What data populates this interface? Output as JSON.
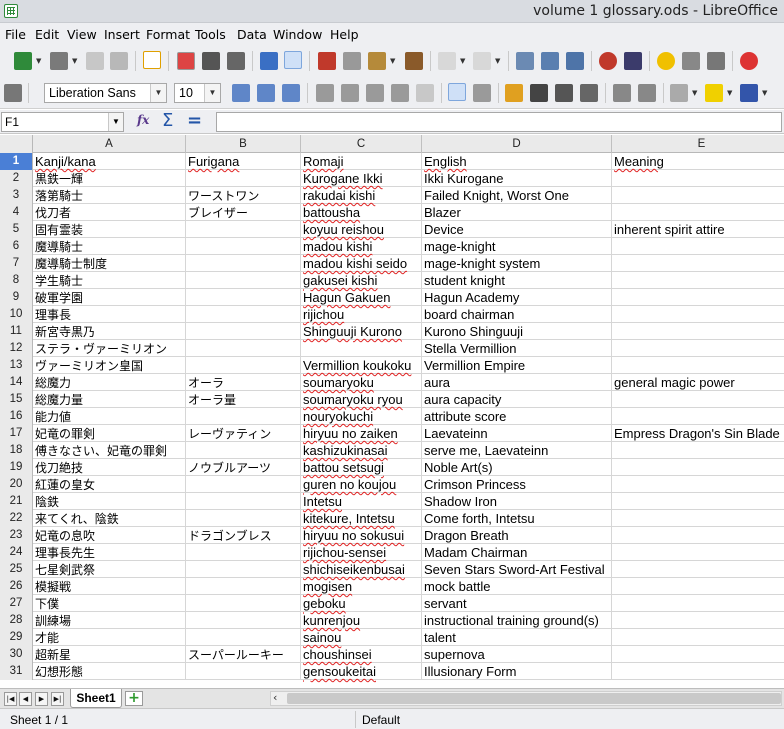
{
  "window": {
    "title": "volume 1 glossary.ods - LibreOffice"
  },
  "menu": [
    "File",
    "Edit",
    "View",
    "Insert",
    "Format",
    "Tools",
    "Data",
    "Window",
    "Help"
  ],
  "format_toolbar": {
    "font_name": "Liberation Sans",
    "font_size": "10"
  },
  "formula_bar": {
    "name_box": "F1",
    "content": ""
  },
  "columns": [
    "A",
    "B",
    "C",
    "D",
    "E"
  ],
  "rows": [
    {
      "n": "1",
      "a": "Kanji/kana",
      "b": "Furigana",
      "c": "Romaji",
      "d": "English",
      "e": "Meaning"
    },
    {
      "n": "2",
      "a": "黒鉄一輝",
      "b": "",
      "c": "Kurogane Ikki",
      "d": "Ikki Kurogane",
      "e": ""
    },
    {
      "n": "3",
      "a": "落第騎士",
      "b": "ワーストワン",
      "c": "rakudai kishi",
      "d": "Failed Knight, Worst One",
      "e": ""
    },
    {
      "n": "4",
      "a": "伐刀者",
      "b": "ブレイザー",
      "c": "battousha",
      "d": "Blazer",
      "e": ""
    },
    {
      "n": "5",
      "a": "固有霊装",
      "b": "",
      "c": "koyuu reishou",
      "d": "Device",
      "e": "inherent spirit attire"
    },
    {
      "n": "6",
      "a": "魔導騎士",
      "b": "",
      "c": "madou kishi",
      "d": "mage-knight",
      "e": ""
    },
    {
      "n": "7",
      "a": "魔導騎士制度",
      "b": "",
      "c": "madou kishi seido",
      "d": "mage-knight system",
      "e": ""
    },
    {
      "n": "8",
      "a": "学生騎士",
      "b": "",
      "c": "gakusei kishi",
      "d": "student knight",
      "e": ""
    },
    {
      "n": "9",
      "a": "破軍学園",
      "b": "",
      "c": "Hagun Gakuen",
      "d": "Hagun Academy",
      "e": ""
    },
    {
      "n": "10",
      "a": "理事長",
      "b": "",
      "c": "rijichou",
      "d": "board chairman",
      "e": ""
    },
    {
      "n": "11",
      "a": "新宮寺黒乃",
      "b": "",
      "c": "Shinguuji Kurono",
      "d": "Kurono Shinguuji",
      "e": ""
    },
    {
      "n": "12",
      "a": "ステラ・ヴァーミリオン",
      "b": "",
      "c": "",
      "d": "Stella Vermillion",
      "e": ""
    },
    {
      "n": "13",
      "a": "ヴァーミリオン皇国",
      "b": "",
      "c": "Vermillion koukoku",
      "d": "Vermillion Empire",
      "e": ""
    },
    {
      "n": "14",
      "a": "総魔力",
      "b": "オーラ",
      "c": "soumaryoku",
      "d": "aura",
      "e": "general magic power"
    },
    {
      "n": "15",
      "a": "総魔力量",
      "b": "オーラ量",
      "c": "soumaryoku ryou",
      "d": "aura capacity",
      "e": ""
    },
    {
      "n": "16",
      "a": "能力値",
      "b": "",
      "c": "nouryokuchi",
      "d": "attribute score",
      "e": ""
    },
    {
      "n": "17",
      "a": "妃竜の罪剣",
      "b": "レーヴァティン",
      "c": "hiryuu no zaiken",
      "d": "Laevateinn",
      "e": "Empress Dragon's Sin Blade"
    },
    {
      "n": "18",
      "a": "傅きなさい、妃竜の罪剣",
      "b": "",
      "c": "kashizukinasai",
      "d": "serve me, Laevateinn",
      "e": ""
    },
    {
      "n": "19",
      "a": "伐刀絶技",
      "b": "ノウブルアーツ",
      "c": "battou setsugi",
      "d": "Noble Art(s)",
      "e": ""
    },
    {
      "n": "20",
      "a": "紅蓮の皇女",
      "b": "",
      "c": "guren no koujou",
      "d": "Crimson Princess",
      "e": ""
    },
    {
      "n": "21",
      "a": "陰鉄",
      "b": "",
      "c": "Intetsu",
      "d": "Shadow Iron",
      "e": ""
    },
    {
      "n": "22",
      "a": "来てくれ、陰鉄",
      "b": "",
      "c": "kitekure, Intetsu",
      "d": "Come forth, Intetsu",
      "e": ""
    },
    {
      "n": "23",
      "a": "妃竜の息吹",
      "b": "ドラゴンブレス",
      "c": "hiryuu no sokusui",
      "d": "Dragon Breath",
      "e": ""
    },
    {
      "n": "24",
      "a": "理事長先生",
      "b": "",
      "c": "rijichou-sensei",
      "d": "Madam Chairman",
      "e": ""
    },
    {
      "n": "25",
      "a": "七星剣武祭",
      "b": "",
      "c": "shichiseikenbusai",
      "d": "Seven Stars Sword-Art Festival",
      "e": ""
    },
    {
      "n": "26",
      "a": "模擬戦",
      "b": "",
      "c": "mogisen",
      "d": "mock battle",
      "e": ""
    },
    {
      "n": "27",
      "a": "下僕",
      "b": "",
      "c": "geboku",
      "d": "servant",
      "e": ""
    },
    {
      "n": "28",
      "a": "訓練場",
      "b": "",
      "c": "kunrenjou",
      "d": "instructional training ground(s)",
      "e": ""
    },
    {
      "n": "29",
      "a": "才能",
      "b": "",
      "c": "sainou",
      "d": "talent",
      "e": ""
    },
    {
      "n": "30",
      "a": "超新星",
      "b": "スーパールーキー",
      "c": "choushinsei",
      "d": "supernova",
      "e": ""
    },
    {
      "n": "31",
      "a": "幻想形態",
      "b": "",
      "c": "gensoukeitai",
      "d": "Illusionary Form",
      "e": ""
    }
  ],
  "sheet_tab": "Sheet1",
  "status": {
    "sheet": "Sheet 1 / 1",
    "page_style": "Default"
  }
}
